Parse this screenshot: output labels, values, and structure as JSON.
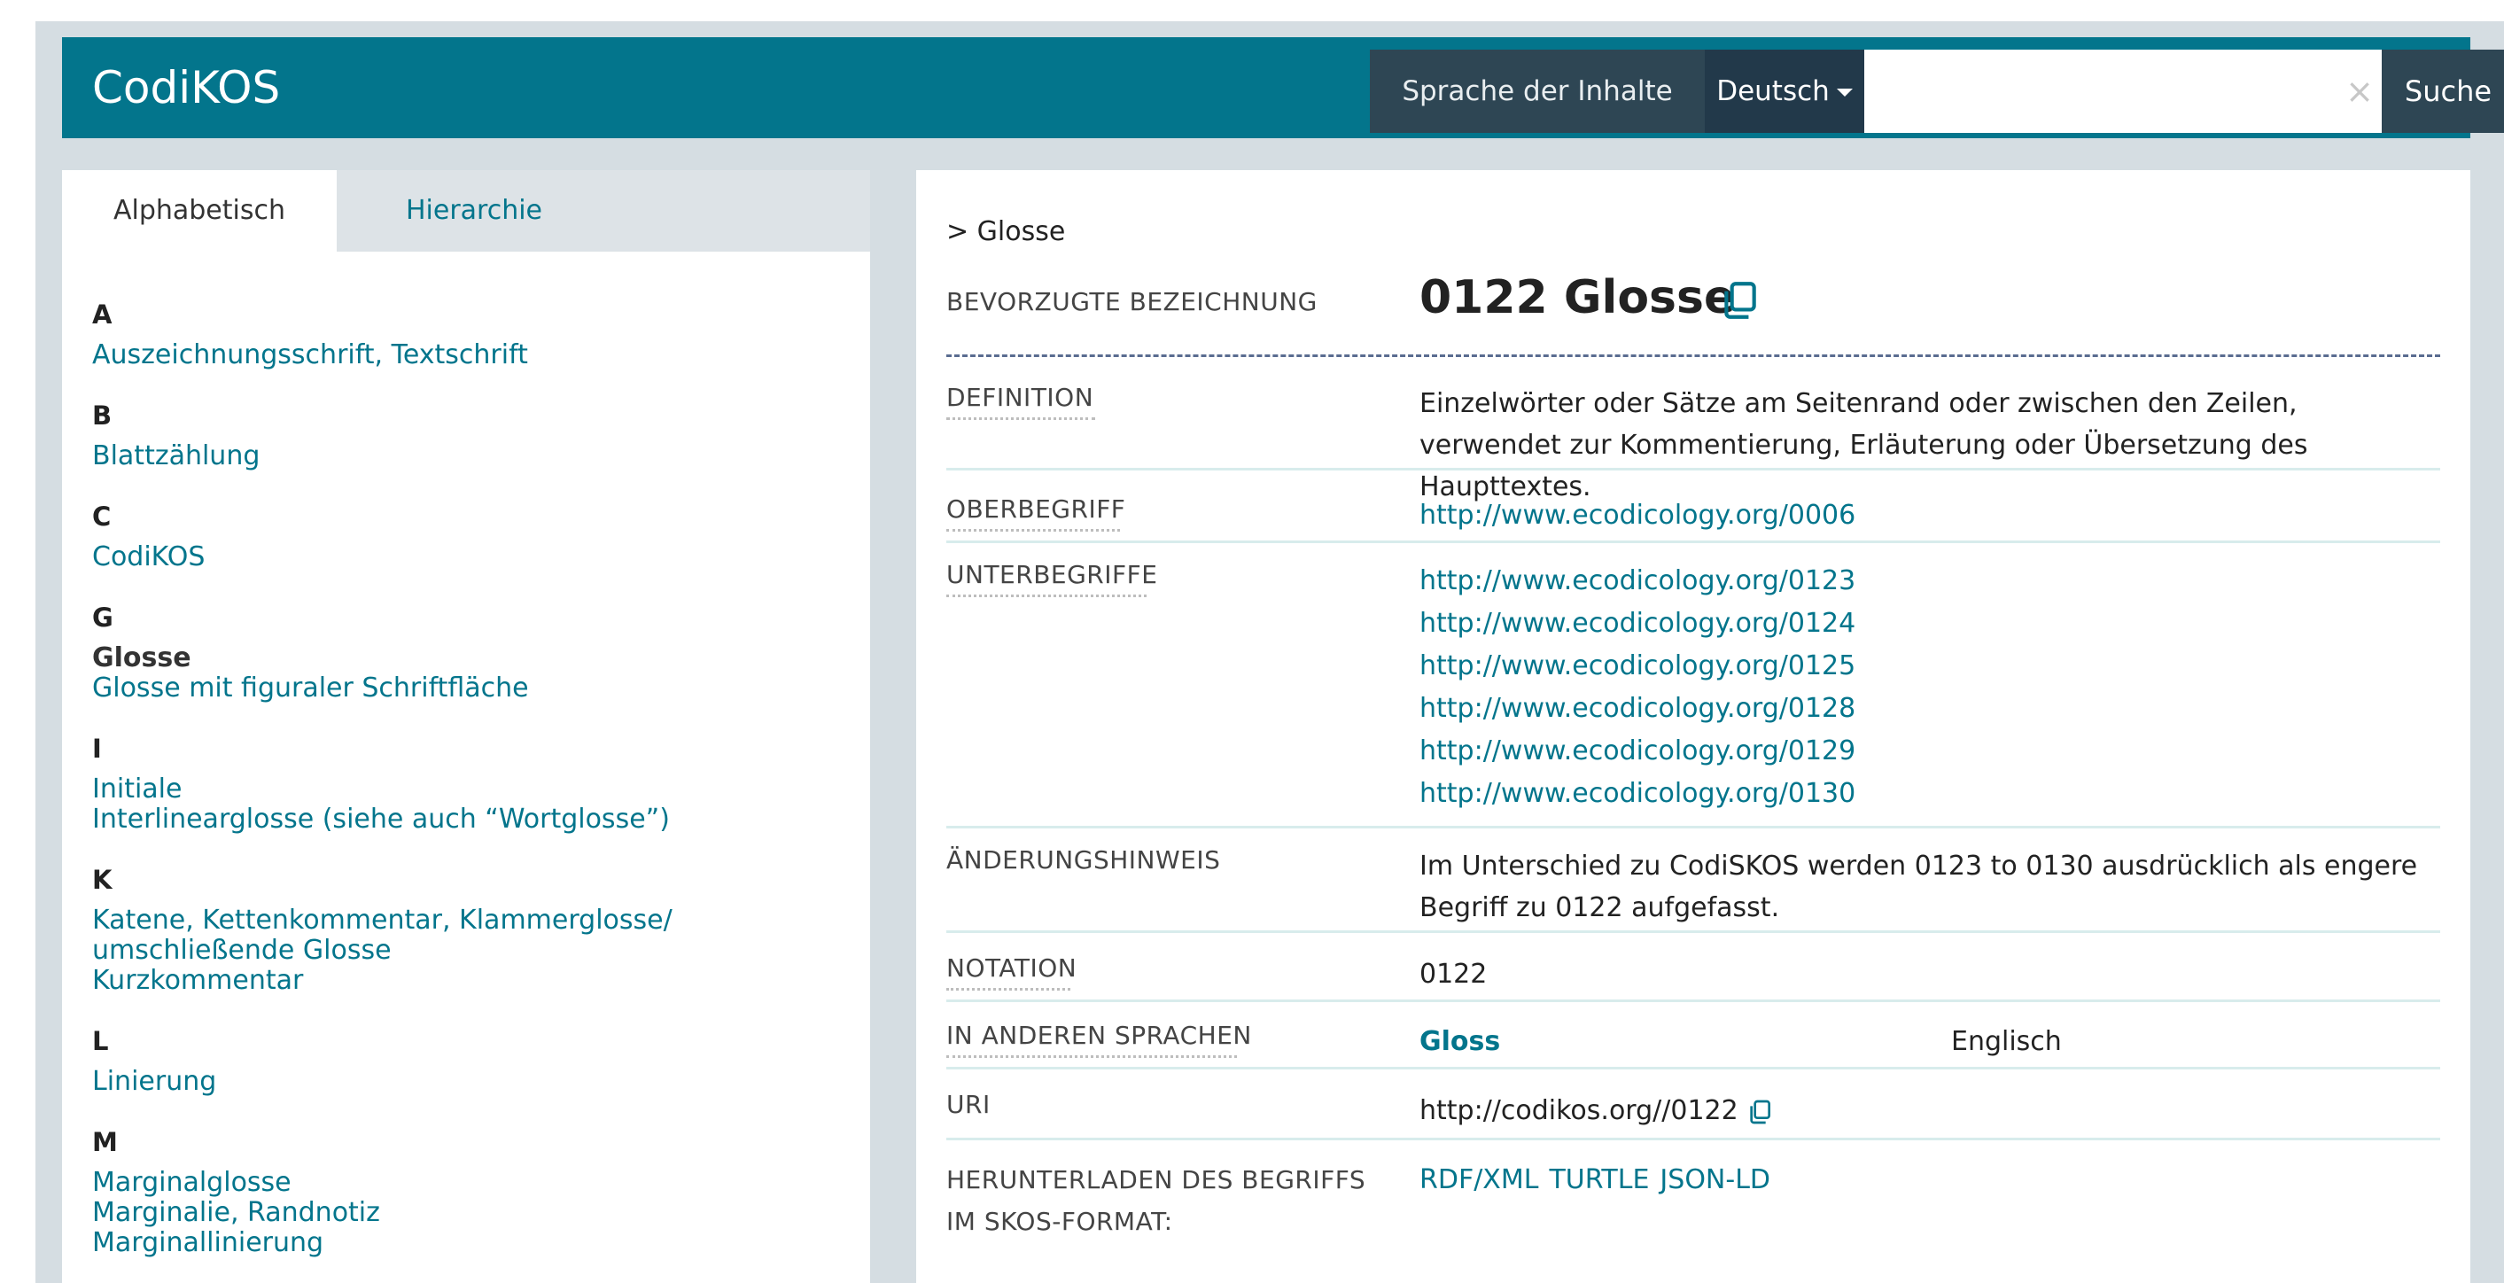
{
  "header": {
    "brand": "CodiKOS",
    "lang_label": "Sprache der Inhalte",
    "lang_selected": "Deutsch",
    "search_placeholder": "",
    "clear": "×",
    "search_button": "Suche"
  },
  "sidebar": {
    "tabs": [
      "Alphabetisch",
      "Hierarchie"
    ],
    "groups": [
      {
        "letter": "A",
        "terms": [
          "Auszeichnungsschrift, Textschrift"
        ]
      },
      {
        "letter": "B",
        "terms": [
          "Blattzählung"
        ]
      },
      {
        "letter": "C",
        "terms": [
          "CodiKOS"
        ]
      },
      {
        "letter": "G",
        "terms": [
          "Glosse",
          "Glosse mit figuraler Schriftfläche"
        ]
      },
      {
        "letter": "I",
        "terms": [
          "Initiale",
          "Interlinearglosse (siehe auch “Wortglosse”)"
        ]
      },
      {
        "letter": "K",
        "terms": [
          "Katene, Kettenkommentar, Klammerglosse/ umschließende Glosse",
          "Kurzkommentar"
        ]
      },
      {
        "letter": "L",
        "terms": [
          "Linierung"
        ]
      },
      {
        "letter": "M",
        "terms": [
          "Marginalglosse",
          "Marginalie, Randnotiz",
          "Marginallinierung"
        ]
      }
    ]
  },
  "main": {
    "breadcrumb": "> Glosse",
    "pref_label": "BEVORZUGTE BEZEICHNUNG",
    "pref_value": "0122  Glosse",
    "definition_label": "DEFINITION",
    "definition_value": "Einzelwörter oder Sätze am Seitenrand oder zwischen den Zeilen, verwendet zur Kommentierung, Erläuterung oder Übersetzung des Haupttextes.",
    "broader_label": "OBERBEGRIFF",
    "broader_value": "http://www.ecodicology.org/0006",
    "narrower_label": "UNTERBEGRIFFE",
    "narrower_values": [
      "http://www.ecodicology.org/0123",
      "http://www.ecodicology.org/0124",
      "http://www.ecodicology.org/0125",
      "http://www.ecodicology.org/0128",
      "http://www.ecodicology.org/0129",
      "http://www.ecodicology.org/0130"
    ],
    "change_label": "ÄNDERUNGSHINWEIS",
    "change_value": "Im Unterschied zu CodiSKOS werden 0123 to 0130 ausdrücklich als engere Begriff zu 0122 aufgefasst.",
    "notation_label": "NOTATION",
    "notation_value": "0122",
    "other_lang_label": "IN ANDEREN SPRACHEN",
    "other_lang_term": "Gloss",
    "other_lang_name": "Englisch",
    "uri_label": "URI",
    "uri_value": "http://codikos.org//0122",
    "download_label_1": "HERUNTERLADEN DES BEGRIFFS",
    "download_label_2": "IM SKOS-FORMAT:",
    "download_links": [
      "RDF/XML",
      "TURTLE",
      "JSON-LD"
    ]
  }
}
